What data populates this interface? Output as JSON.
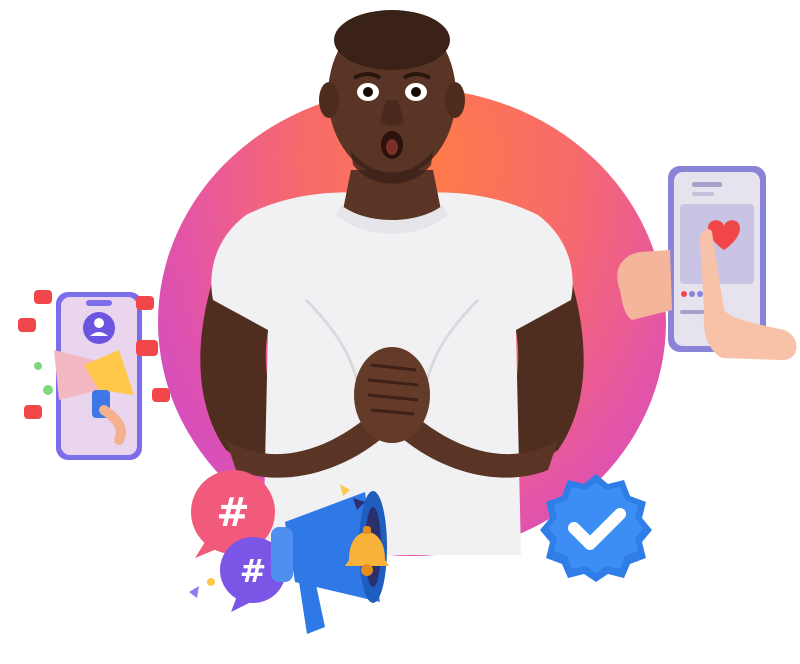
{
  "illustration": {
    "colors": {
      "blob_top": "#ff7a4a",
      "blob_bottom": "#c246d9",
      "skin": "#5a3424",
      "shirt": "#f1f1f3",
      "badge_blue": "#2f7de6",
      "heart_red": "#f2474a",
      "hashtag_pink": "#f15a7a",
      "hashtag_purple": "#7b55e6",
      "megaphone_blue": "#2e79e6",
      "bell_yellow": "#f7b23a"
    },
    "icons": {
      "left_phone": "social-phone-icon",
      "right_phone": "like-phone-icon",
      "hashtags": "hashtag-bubble-icon",
      "megaphone": "megaphone-icon",
      "bell": "bell-icon",
      "badge": "verified-badge-icon"
    },
    "hashtag_symbol": "#"
  }
}
